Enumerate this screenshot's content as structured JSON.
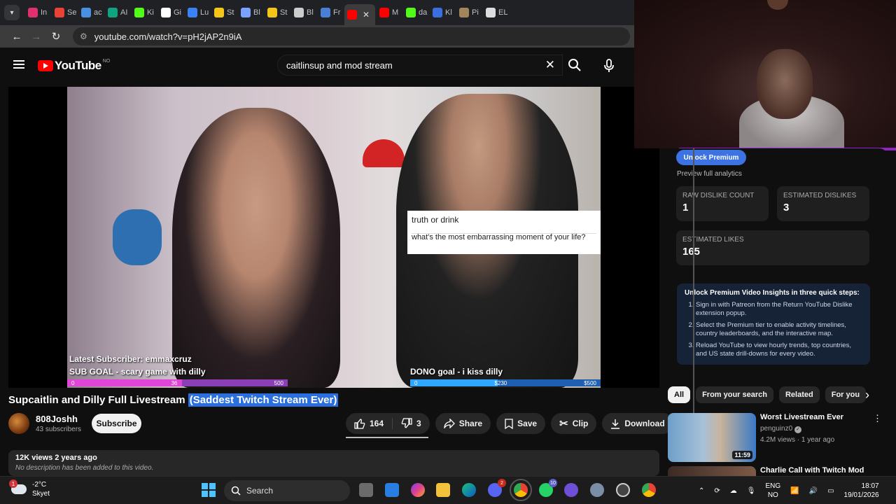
{
  "browser": {
    "tabs": [
      {
        "label": "In",
        "icon": "instagram-icon",
        "color": "#e1306c"
      },
      {
        "label": "Se",
        "icon": "gmail-icon",
        "color": "#ea4335"
      },
      {
        "label": "ac",
        "icon": "search-icon",
        "color": "#4a90e2"
      },
      {
        "label": "AI",
        "icon": "openai-icon",
        "color": "#10a37f"
      },
      {
        "label": "Ki",
        "icon": "kick-icon",
        "color": "#53fc18"
      },
      {
        "label": "Gi",
        "icon": "rt-icon",
        "color": "#ffffff"
      },
      {
        "label": "Lu",
        "icon": "lunar-icon",
        "color": "#3b82f6"
      },
      {
        "label": "St",
        "icon": "crown-icon",
        "color": "#f5c518"
      },
      {
        "label": "Bl",
        "icon": "blue-x-icon",
        "color": "#7aa2ff"
      },
      {
        "label": "St",
        "icon": "crown-icon",
        "color": "#f5c518"
      },
      {
        "label": "Bl",
        "icon": "openai-icon",
        "color": "#cccccc"
      },
      {
        "label": "Fr",
        "icon": "doc-icon",
        "color": "#4a7fd6"
      },
      {
        "label": "",
        "icon": "youtube-icon",
        "color": "#ff0000",
        "active": true
      },
      {
        "label": "M",
        "icon": "youtube-icon",
        "color": "#ff0000"
      },
      {
        "label": "da",
        "icon": "kick-icon",
        "color": "#53fc18"
      },
      {
        "label": "Kl",
        "icon": "shield-icon",
        "color": "#3b6fe0"
      },
      {
        "label": "Pi",
        "icon": "image-icon",
        "color": "#a0865a"
      },
      {
        "label": "EL",
        "icon": "el-icon",
        "color": "#dddddd"
      }
    ],
    "url": "youtube.com/watch?v=pH2jAP2n9iA"
  },
  "youtube": {
    "logo_text": "YouTube",
    "country_code": "NO",
    "search_query": "caitlinsup and mod stream"
  },
  "video": {
    "overlay": {
      "question_title": "truth or drink",
      "question_text": "what's the most embarrassing moment of your life?",
      "latest_subscriber": "Latest Subscriber: emmaxcruz",
      "sub_goal": "SUB GOAL - scary game with dilly",
      "dono_goal": "DONO goal - i kiss dilly",
      "sub_bar": {
        "start": "0",
        "current": "36",
        "target": "500",
        "progress": 0.52
      },
      "dono_bar": {
        "start": "0",
        "current": "$230",
        "target": "$500",
        "progress": 0.46
      }
    },
    "title_plain": "Supcaitlin and Dilly Full Livestream ",
    "title_highlight": "(Saddest Twitch Stream Ever)",
    "channel": {
      "name": "808Joshh",
      "subs": "43 subscribers",
      "subscribe_label": "Subscribe"
    },
    "actions": {
      "likes": "164",
      "dislikes": "3",
      "share": "Share",
      "save": "Save",
      "clip": "Clip",
      "download": "Download"
    },
    "views_line": "12K views  2 years ago",
    "description": "No description has been added to this video."
  },
  "ryd": {
    "unlock_label": "Unlock Premium",
    "preview_text": "Preview full analytics",
    "raw_dislike_label": "RAW DISLIKE COUNT",
    "raw_dislike_value": "1",
    "est_dislikes_label": "ESTIMATED DISLIKES",
    "est_dislikes_value": "3",
    "est_likes_label": "ESTIMATED LIKES",
    "est_likes_value": "165",
    "steps_title": "Unlock Premium Video Insights in three quick steps:",
    "steps": [
      "Sign in with Patreon from the Return YouTube Dislike extension popup.",
      "Select the Premium tier to enable activity timelines, country leaderboards, and the interactive map.",
      "Reload YouTube to view hourly trends, top countries, and US state drill-downs for every video."
    ]
  },
  "chips": [
    "All",
    "From your search",
    "Related",
    "For you"
  ],
  "recommendations": [
    {
      "title": "Worst Livestream Ever",
      "channel": "penguinz0",
      "stats": "4.2M views · 1 year ago",
      "duration": "11:59",
      "verified": true
    },
    {
      "title": "Charlie Call with Twitch Mod",
      "channel": "",
      "stats": "",
      "duration": "",
      "verified": false
    }
  ],
  "taskbar": {
    "weather_temp": "-2°C",
    "weather_desc": "Skyet",
    "weather_badge": "1",
    "search_label": "Search",
    "lang1": "ENG",
    "lang2": "NO",
    "time": "18:07",
    "date": "19/01/2026",
    "discord_badge": "2",
    "whatsapp_badge": "10"
  },
  "colors": {
    "accent_blue": "#3c72e2",
    "yt_red": "#ff0000",
    "purple_strip": "#8e24c8"
  }
}
